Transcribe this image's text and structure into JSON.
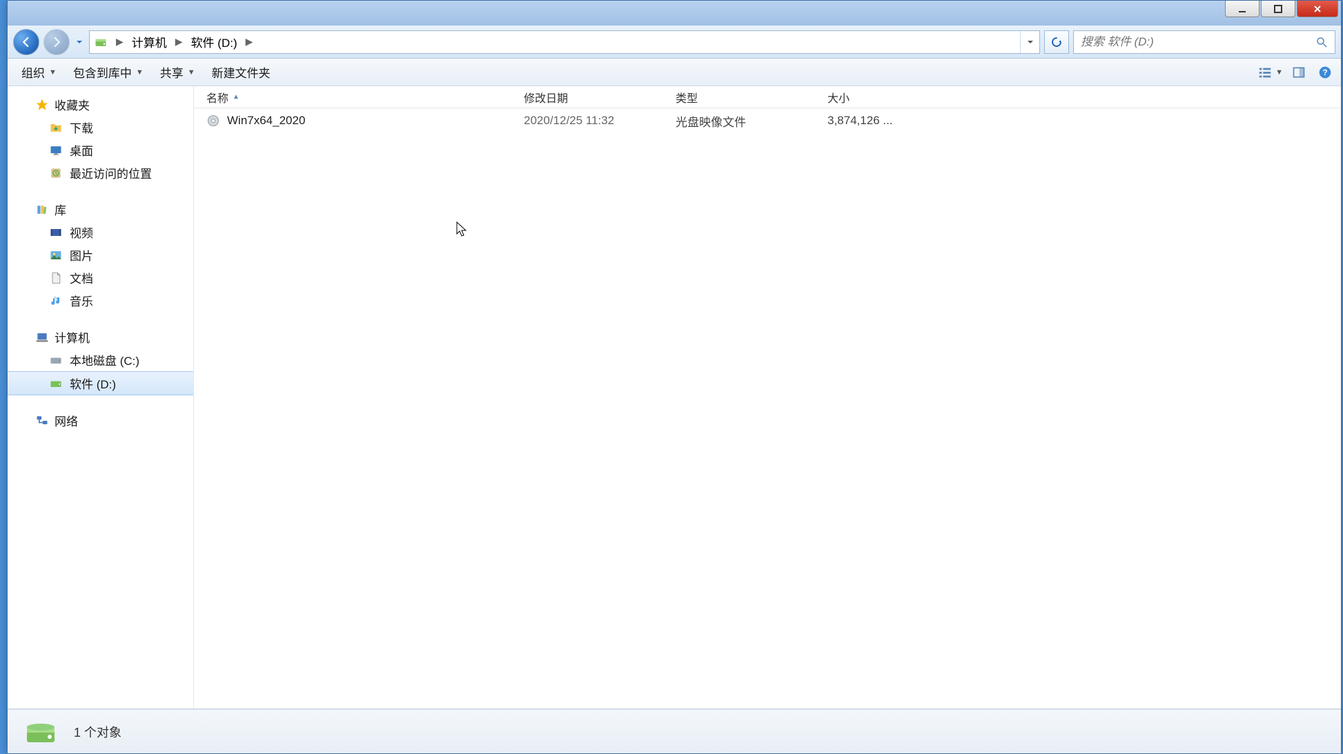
{
  "breadcrumb": {
    "seg1": "计算机",
    "seg2": "软件 (D:)"
  },
  "search": {
    "placeholder": "搜索 软件 (D:)"
  },
  "toolbar": {
    "organize": "组织",
    "include": "包含到库中",
    "share": "共享",
    "newfolder": "新建文件夹"
  },
  "sidebar": {
    "favorites": {
      "label": "收藏夹",
      "items": [
        {
          "label": "下载"
        },
        {
          "label": "桌面"
        },
        {
          "label": "最近访问的位置"
        }
      ]
    },
    "libraries": {
      "label": "库",
      "items": [
        {
          "label": "视频"
        },
        {
          "label": "图片"
        },
        {
          "label": "文档"
        },
        {
          "label": "音乐"
        }
      ]
    },
    "computer": {
      "label": "计算机",
      "items": [
        {
          "label": "本地磁盘 (C:)"
        },
        {
          "label": "软件 (D:)",
          "selected": true
        }
      ]
    },
    "network": {
      "label": "网络"
    }
  },
  "columns": {
    "name": "名称",
    "date": "修改日期",
    "type": "类型",
    "size": "大小"
  },
  "files": [
    {
      "name": "Win7x64_2020",
      "date": "2020/12/25 11:32",
      "type": "光盘映像文件",
      "size": "3,874,126 ..."
    }
  ],
  "status": {
    "text": "1 个对象"
  }
}
